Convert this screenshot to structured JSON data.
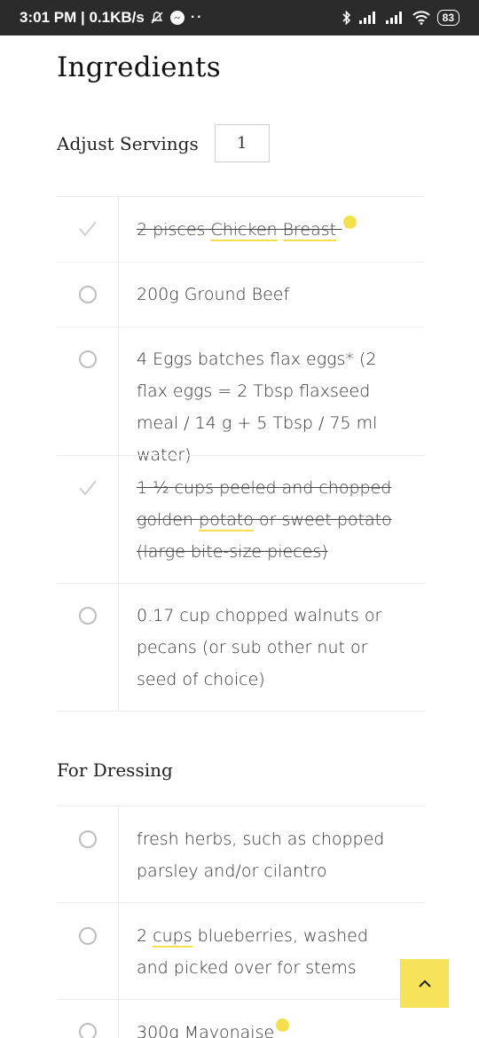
{
  "status_bar": {
    "time_net": "3:01 PM | 0.1KB/s",
    "battery": "83",
    "icons": [
      "mute-icon",
      "messenger-icon",
      "more-dots-icon",
      "bluetooth-icon",
      "signal-icon",
      "signal-icon",
      "wifi-icon",
      "battery-icon"
    ]
  },
  "title": "Ingredients",
  "servings": {
    "label": "Adjust Servings",
    "value": "1"
  },
  "ingredients": [
    {
      "text_a": "2 pisces ",
      "hl1": "Chicken",
      "text_b": " ",
      "hl2": "Breast",
      "text_c": " ",
      "checked": true
    },
    {
      "text": "200g Ground Beef",
      "checked": false
    },
    {
      "text": "4 Eggs batches flax eggs* (2 flax eggs = 2 Tbsp flaxseed meal / 14 g + 5 Tbsp / 75 ml water)",
      "checked": false
    },
    {
      "text_a": "1 ½ cups peeled and chopped golden ",
      "hl1": "potato",
      "text_b": " or sweet potato (large bite-size pieces)",
      "checked": true
    },
    {
      "text": "0.17 cup chopped walnuts or pecans (or sub other nut or seed of choice)",
      "checked": false
    }
  ],
  "dressing_title": "For Dressing",
  "dressing": [
    {
      "text": "fresh herbs, such as chopped parsley and/or cilantro",
      "checked": false
    },
    {
      "text_a": "2 ",
      "hl1": "cups",
      "text_b": " blueberries, washed and picked over for stems",
      "checked": false
    },
    {
      "text": "300g Mayonaise",
      "checked": false
    }
  ],
  "colors": {
    "accent_yellow": "#f7e35a",
    "highlight": "#f4e04d",
    "status_bg": "#2b2b2b"
  }
}
